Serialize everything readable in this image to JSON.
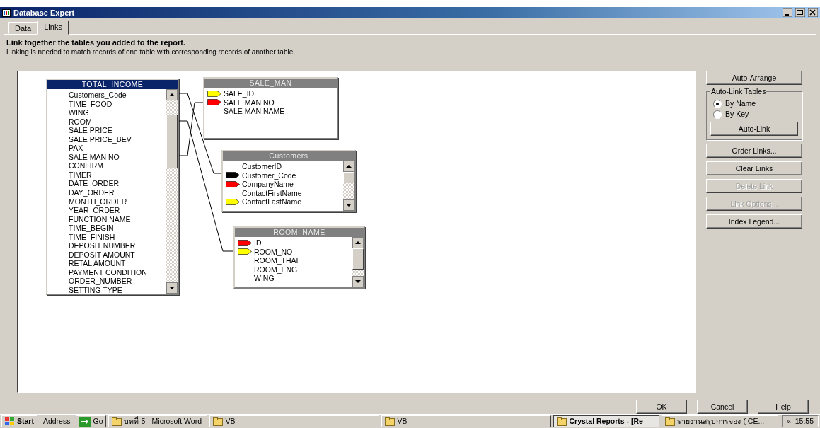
{
  "window": {
    "title": "Database Expert"
  },
  "tabs": [
    {
      "label": "Data",
      "selected": false
    },
    {
      "label": "Links",
      "selected": true
    }
  ],
  "instructions": {
    "heading": "Link together the tables you added to the report.",
    "text": "Linking is needed to match records of one table with corresponding records of another table."
  },
  "tables": [
    {
      "name": "TOTAL_INCOME",
      "selected": true,
      "fields": [
        {
          "name": "Customers_Code"
        },
        {
          "name": "TIME_FOOD"
        },
        {
          "name": "WING"
        },
        {
          "name": "ROOM"
        },
        {
          "name": "SALE PRICE"
        },
        {
          "name": "SALE PRICE_BEV"
        },
        {
          "name": "PAX"
        },
        {
          "name": "SALE MAN NO"
        },
        {
          "name": "CONFIRM"
        },
        {
          "name": "TIMER"
        },
        {
          "name": "DATE_ORDER"
        },
        {
          "name": "DAY_ORDER"
        },
        {
          "name": "MONTH_ORDER"
        },
        {
          "name": "YEAR_ORDER"
        },
        {
          "name": "FUNCTION NAME"
        },
        {
          "name": "TIME_BEGIN"
        },
        {
          "name": "TIME_FINISH"
        },
        {
          "name": "DEPOSIT NUMBER"
        },
        {
          "name": "DEPOSIT AMOUNT"
        },
        {
          "name": "RETAL AMOUNT"
        },
        {
          "name": "PAYMENT CONDITION"
        },
        {
          "name": "ORDER_NUMBER"
        },
        {
          "name": "SETTING TYPE"
        }
      ]
    },
    {
      "name": "SALE_MAN",
      "selected": false,
      "fields": [
        {
          "name": "SALE_ID",
          "color": "#ffff00"
        },
        {
          "name": "SALE MAN NO",
          "color": "#ff0000"
        },
        {
          "name": "SALE MAN NAME"
        }
      ]
    },
    {
      "name": "Customers",
      "selected": false,
      "fields": [
        {
          "name": "CustomerID"
        },
        {
          "name": "Customer_Code",
          "color": "#000000"
        },
        {
          "name": "CompanyName",
          "color": "#ff0000"
        },
        {
          "name": "ContactFirstName"
        },
        {
          "name": "ContactLastName",
          "color": "#ffff00"
        }
      ]
    },
    {
      "name": "ROOM_NAME",
      "selected": false,
      "fields": [
        {
          "name": "ID",
          "color": "#ff0000"
        },
        {
          "name": "ROOM_NO",
          "color": "#ffff00"
        },
        {
          "name": "ROOM_THAI"
        },
        {
          "name": "ROOM_ENG"
        },
        {
          "name": "WING"
        }
      ]
    }
  ],
  "auto_arrange": {
    "label": "Auto-Arrange",
    "disabled": false
  },
  "auto_link": {
    "title": "Auto-Link Tables",
    "options": [
      {
        "label": "By Name",
        "selected": true
      },
      {
        "label": "By Key",
        "selected": false
      }
    ],
    "button": {
      "label": "Auto-Link",
      "disabled": false
    }
  },
  "link_buttons": [
    {
      "label": "Order Links...",
      "disabled": false
    },
    {
      "label": "Clear Links",
      "disabled": false
    },
    {
      "label": "Delete Link",
      "disabled": true
    },
    {
      "label": "Link Options...",
      "disabled": true
    },
    {
      "label": "Index Legend...",
      "disabled": false
    }
  ],
  "dialog_buttons": [
    {
      "label": "OK"
    },
    {
      "label": "Cancel"
    },
    {
      "label": "Help"
    }
  ],
  "taskbar": {
    "start": "Start",
    "address": "Address",
    "go": "Go",
    "tasks": [
      {
        "label": "บทที่ 5 - Microsoft Word",
        "selected": false
      },
      {
        "label": "VB",
        "selected": false
      },
      {
        "label": "VB",
        "selected": false
      },
      {
        "label": "Crystal Reports - [Re",
        "selected": true
      },
      {
        "label": "รายงานสรุปการจอง ( CE...",
        "selected": false
      }
    ],
    "chevron": "«",
    "time": "15:55"
  }
}
